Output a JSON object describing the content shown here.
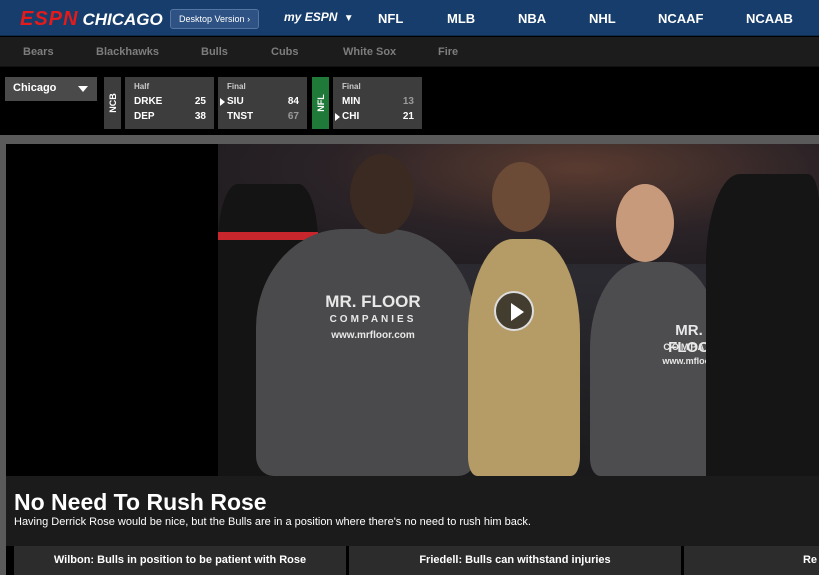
{
  "header": {
    "brand_espn": "ESPN",
    "brand_city": "CHICAGO",
    "desktop_version": "Desktop Version",
    "my_espn_prefix": "my",
    "my_espn_logo": "ESPN",
    "nav": [
      "NFL",
      "MLB",
      "NBA",
      "NHL",
      "NCAAF",
      "NCAAB"
    ]
  },
  "subnav": [
    "Bears",
    "Blackhawks",
    "Bulls",
    "Cubs",
    "White Sox",
    "Fire"
  ],
  "scores": {
    "city_select": "Chicago",
    "leagues": [
      {
        "label": "NCB",
        "color": "#3d3d3d"
      },
      {
        "label": "NFL",
        "color": "#1f7a3a"
      }
    ],
    "games": [
      {
        "status": "Half",
        "team1": "DRKE",
        "score1": "25",
        "team2": "DEP",
        "score2": "38"
      },
      {
        "status": "Final",
        "team1": "SIU",
        "score1": "84",
        "team2": "TNST",
        "score2": "67"
      },
      {
        "status": "Final",
        "team1": "MIN",
        "score1": "13",
        "team2": "CHI",
        "score2": "21"
      }
    ]
  },
  "hero": {
    "shirt_text_1": "MR. FLOOR",
    "shirt_text_2": "COMPANIES",
    "shirt_text_3": "www.mrfloor.com",
    "shirt_text_right_1": "MR. FLOO",
    "shirt_text_right_2": "COMPAN",
    "shirt_text_right_3": "www.mfloor.",
    "headline": "No Need To Rush Rose",
    "dek": "Having Derrick Rose would be nice, but the Bulls are in a position where there's no need to rush him back."
  },
  "related_links": [
    "Wilbon: Bulls in position to be patient with Rose",
    "Friedell: Bulls can withstand injuries",
    "Re"
  ],
  "colors": {
    "header_bg": "#163d6b",
    "brand_red": "#e51a1a"
  }
}
